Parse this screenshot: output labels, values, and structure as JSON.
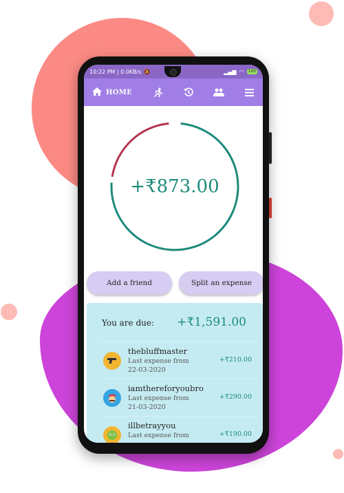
{
  "status_bar": {
    "time": "10:22 PM | 0.0KB/s",
    "battery": "100"
  },
  "app_bar": {
    "home_label": "HOME",
    "icons": [
      "home-icon",
      "running-icon",
      "history-icon",
      "friends-icon",
      "menu-icon"
    ]
  },
  "balance": {
    "amount": "+₹873.00",
    "ring_colors": {
      "owed": "#1b8a7a",
      "owes": "#b5344f"
    },
    "owed_fraction": 0.76
  },
  "actions": {
    "add_friend": "Add a friend",
    "split_expense": "Split an expense"
  },
  "due": {
    "label": "You are due:",
    "total": "+₹1,591.00",
    "items": [
      {
        "name": "thebluffmaster",
        "subtitle_line1": "Last expense from",
        "subtitle_line2": "22-03-2020",
        "amount": "+₹210.00",
        "avatar": "gun-icon"
      },
      {
        "name": "iamthereforyoubro",
        "subtitle_line1": "Last expense from",
        "subtitle_line2": "21-03-2020",
        "amount": "+₹290.00",
        "avatar": "mario-icon"
      },
      {
        "name": "illbetrayyou",
        "subtitle_line1": "Last expense from",
        "subtitle_line2": "",
        "amount": "+₹190.00",
        "avatar": "alien-icon"
      }
    ]
  },
  "colors": {
    "appbar": "#a17ee6",
    "statusbar": "#8a67c7",
    "button": "#d7ccf2",
    "panel": "#c5ebf2",
    "accent": "#1b8a7a"
  }
}
